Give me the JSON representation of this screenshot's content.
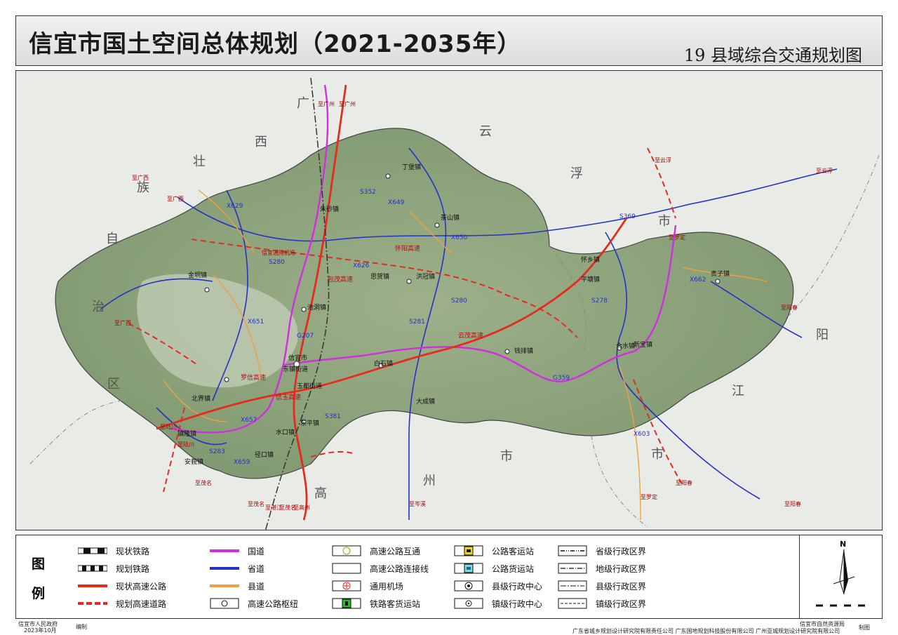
{
  "title": {
    "main": "信宜市国土空间总体规划（2021-2035年）",
    "sub": "19 县域综合交通规划图"
  },
  "map": {
    "regions": [
      "广",
      "西",
      "壮",
      "族",
      "自",
      "治",
      "区",
      "云",
      "浮",
      "市",
      "阳",
      "江",
      "市",
      "高",
      "州",
      "市"
    ],
    "towns": [
      "信宜市",
      "东镇街道",
      "玉都街道",
      "水口镇",
      "北界镇",
      "金垌镇",
      "池洞镇",
      "丁堡镇",
      "钱排镇",
      "合水镇",
      "新宝镇",
      "怀乡镇",
      "茶山镇",
      "贵子镇",
      "朱砂镇",
      "平塘镇",
      "白石镇",
      "大成镇",
      "洪冠镇",
      "思贺镇",
      "镇隆镇",
      "径口镇",
      "安莪镇",
      "东平镇"
    ],
    "roads": [
      "S280",
      "S352",
      "X649",
      "X650",
      "S281",
      "G207",
      "S369",
      "S278",
      "X629",
      "X651",
      "X659",
      "S283",
      "G359",
      "X603",
      "X662",
      "X657",
      "S280",
      "X626",
      "S381"
    ],
    "expressways": [
      "包茂高速",
      "云茂高速",
      "罗信高速",
      "怀阳高速",
      "信玉高速"
    ],
    "directions": [
      "至广西",
      "至广西",
      "至广西",
      "至陆川",
      "至陆川",
      "至茂名",
      "至茂名",
      "至湛江",
      "至茂名",
      "至高州",
      "至阳春",
      "至阳春",
      "至阳春",
      "至云浮",
      "至云浮",
      "至罗定",
      "至罗定",
      "至广州",
      "至广州",
      "至岑溪"
    ],
    "airport": "信宜通用机场"
  },
  "legend": {
    "title_chars": [
      "图",
      "例"
    ],
    "items": [
      {
        "label": "现状铁路",
        "sym": "rail-current"
      },
      {
        "label": "规划铁路",
        "sym": "rail-plan"
      },
      {
        "label": "现状高速公路",
        "sym": "expressway-current"
      },
      {
        "label": "规划高速道路",
        "sym": "expressway-plan"
      },
      {
        "label": "国道",
        "sym": "national-road"
      },
      {
        "label": "省道",
        "sym": "provincial-road"
      },
      {
        "label": "县道",
        "sym": "county-road"
      },
      {
        "label": "高速公路枢纽",
        "sym": "expressway-hub"
      },
      {
        "label": "高速公路互通",
        "sym": "interchange"
      },
      {
        "label": "高速公路连接线",
        "sym": "connector"
      },
      {
        "label": "通用机场",
        "sym": "airport"
      },
      {
        "label": "铁路客货运站",
        "sym": "rail-station"
      },
      {
        "label": "公路客运站",
        "sym": "bus-station"
      },
      {
        "label": "公路货运站",
        "sym": "freight-station"
      },
      {
        "label": "县级行政中心",
        "sym": "county-center"
      },
      {
        "label": "镇级行政中心",
        "sym": "town-center"
      },
      {
        "label": "省级行政区界",
        "sym": "prov-boundary"
      },
      {
        "label": "地级行政区界",
        "sym": "city-boundary"
      },
      {
        "label": "县级行政区界",
        "sym": "county-boundary"
      },
      {
        "label": "镇级行政区界",
        "sym": "town-boundary"
      }
    ],
    "north": "N"
  },
  "footer": {
    "gov": "信宜市人民政府",
    "date": "2023年10月",
    "compile": "编制",
    "units": "广东省城乡规划设计研究院有限责任公司  广东国地规划科技股份有限公司  广州亚城规划设计研究院有限公司",
    "bureau": "信宜市自然资源局",
    "make": "制图"
  },
  "colors": {
    "expressway": "#e52b1e",
    "national": "#d02ee0",
    "provincial": "#2233c8",
    "county": "#f0a040",
    "terrain": "#8fa77c"
  }
}
